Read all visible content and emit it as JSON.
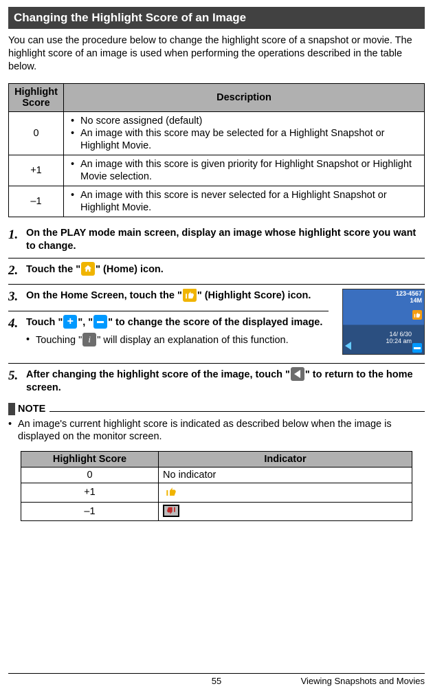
{
  "heading": "Changing the Highlight Score of an Image",
  "intro": "You can use the procedure below to change the highlight score of a snapshot or movie. The highlight score of an image is used when performing the operations described in the table below.",
  "desc_table": {
    "headers": [
      "Highlight Score",
      "Description"
    ],
    "rows": [
      {
        "score": "0",
        "items": [
          "No score assigned (default)",
          "An image with this score may be selected for a Highlight Snapshot or Highlight Movie."
        ]
      },
      {
        "score": "+1",
        "items": [
          "An image with this score is given priority for Highlight Snapshot or Highlight Movie selection."
        ]
      },
      {
        "score": "–1",
        "items": [
          "An image with this score is never selected for a Highlight Snapshot or Highlight Movie."
        ]
      }
    ]
  },
  "steps": {
    "s1": {
      "num": "1.",
      "text_a": "On the PLAY mode main screen, display an image whose highlight score you want to change."
    },
    "s2": {
      "num": "2.",
      "text_a": "Touch the \"",
      "text_b": "\" (Home) icon."
    },
    "s3": {
      "num": "3.",
      "text_a": "On the Home Screen, touch the \"",
      "text_b": "\" (Highlight Score) icon."
    },
    "s4": {
      "num": "4.",
      "text_a": "Touch \"",
      "text_b": "\", \"",
      "text_c": "\" to change the score of the displayed image.",
      "sub_a": "Touching \"",
      "sub_b": "\" will display an explanation of this function."
    },
    "s5": {
      "num": "5.",
      "text_a": "After changing the highlight score of the image, touch \"",
      "text_b": "\" to return to the home screen."
    }
  },
  "note": {
    "label": "NOTE",
    "body": "An image's current highlight score is indicated as described below when the image is displayed on the monitor screen."
  },
  "ind_table": {
    "headers": [
      "Highlight Score",
      "Indicator"
    ],
    "rows": [
      {
        "score": "0",
        "indicator_text": "No indicator"
      },
      {
        "score": "+1",
        "indicator_icon": "thumb-up"
      },
      {
        "score": "–1",
        "indicator_icon": "thumb-down"
      }
    ]
  },
  "preview": {
    "id": "123-4567",
    "res": "14M",
    "dateline1": "14/ 6/30",
    "dateline2": "10:24 am"
  },
  "footer": {
    "page": "55",
    "section": "Viewing Snapshots and Movies"
  }
}
